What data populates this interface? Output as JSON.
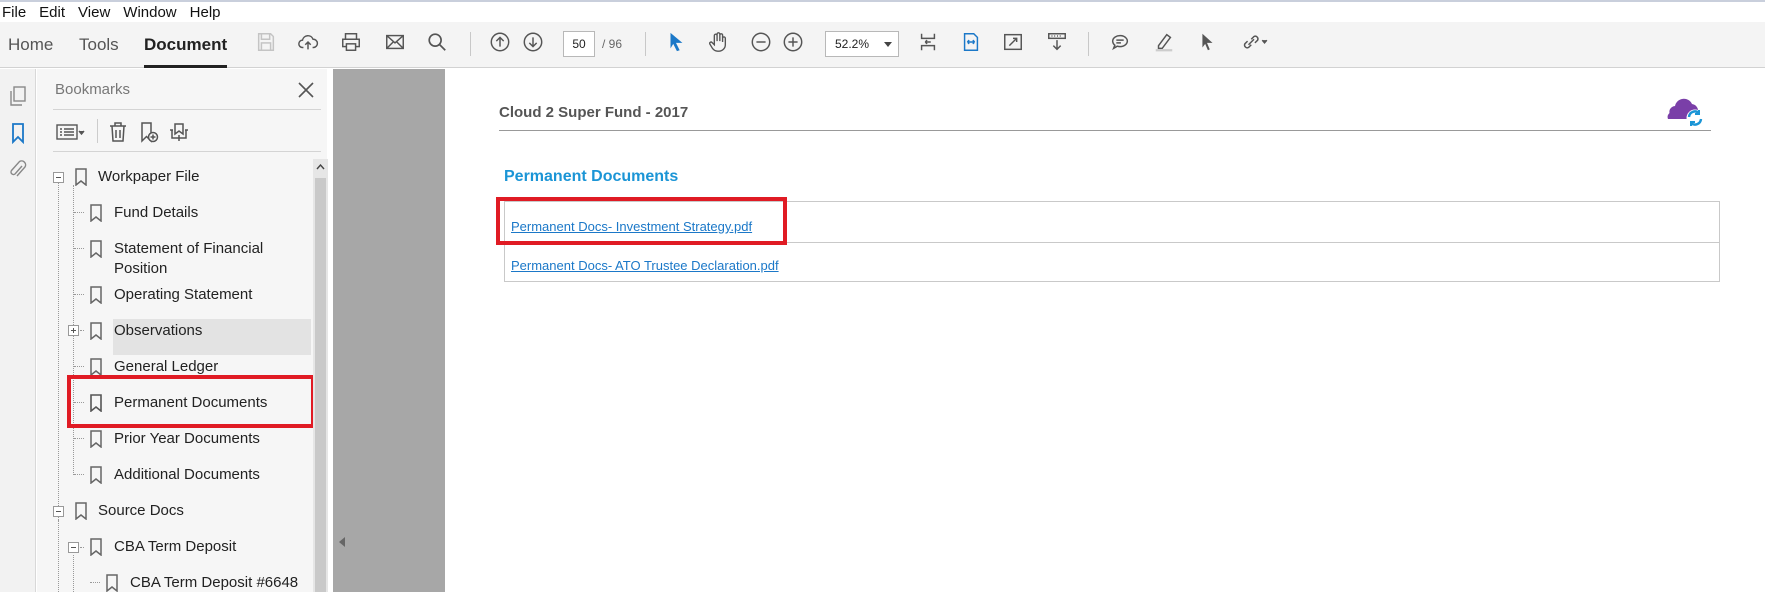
{
  "menu": [
    "File",
    "Edit",
    "View",
    "Window",
    "Help"
  ],
  "toolbar": {
    "tabs": [
      "Home",
      "Tools",
      "Document"
    ],
    "active_tab": "Document",
    "page_current": "50",
    "page_total": "/ 96",
    "zoom": "52.2%"
  },
  "bookmarks": {
    "title": "Bookmarks",
    "items": [
      {
        "label": "Workpaper File",
        "level": 0,
        "expander": "minus"
      },
      {
        "label": "Fund Details",
        "level": 1
      },
      {
        "label": "Statement of Financial",
        "label2": "Position",
        "level": 1
      },
      {
        "label": "Operating Statement",
        "level": 1
      },
      {
        "label": "Observations",
        "level": 1,
        "expander": "plus"
      },
      {
        "label": "General Ledger",
        "level": 1
      },
      {
        "label": "Permanent Documents",
        "level": 1,
        "selected": true
      },
      {
        "label": "Prior Year Documents",
        "level": 1
      },
      {
        "label": "Additional Documents",
        "level": 1
      },
      {
        "label": "Source Docs",
        "level": 0,
        "expander": "minus"
      },
      {
        "label": "CBA Term Deposit",
        "level": 1,
        "expander": "minus"
      },
      {
        "label": "CBA Term Deposit #6648",
        "level": 2
      }
    ]
  },
  "document": {
    "header": "Cloud 2 Super Fund - 2017",
    "section_title": "Permanent Documents",
    "links": [
      "Permanent Docs- Investment Strategy.pdf",
      "Permanent Docs- ATO Trustee Declaration.pdf"
    ]
  },
  "colors": {
    "accent_link": "#1b78c8",
    "section_title": "#1b95d6",
    "highlight_red": "#e01b24"
  }
}
